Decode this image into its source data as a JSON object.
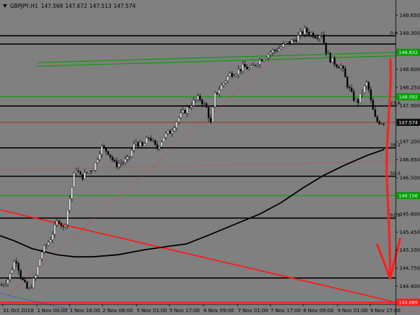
{
  "header": {
    "symbol": "GBPJPY,H1",
    "open": "147.568",
    "high": "147.672",
    "low": "147.513",
    "close": "147.574"
  },
  "colors": {
    "background": "#808080",
    "bull": "#000000",
    "bear": "#000000",
    "level_black": "#000000",
    "level_green": "#0a9c0a",
    "trend_red": "#ff1a1a",
    "ma": "#000000",
    "annotation": "#ff2020",
    "price_badge": "#111111",
    "green_badge": "#0a9c0a",
    "red_badge": "#ff1a1a"
  },
  "chart_data": {
    "type": "candlestick",
    "symbol": "GBPJPY",
    "timeframe": "H1",
    "ylim": [
      144.05,
      149.75
    ],
    "y_ticks": [
      "149.650",
      "149.300",
      "148.950",
      "148.600",
      "148.250",
      "147.900",
      "147.200",
      "146.850",
      "146.500",
      "145.800",
      "145.450",
      "145.100",
      "144.750",
      "144.400"
    ],
    "x_ticks": [
      "31 Oct 2018",
      "1 Nov 00:00",
      "1 Nov 16:00",
      "2 Nov 08:00",
      "5 Nov 01:00",
      "5 Nov 17:00",
      "6 Nov 09:00",
      "7 Nov 01:00",
      "7 Nov 17:00",
      "8 Nov 09:00",
      "9 Nov 01:00",
      "9 Nov 17:00"
    ],
    "current_price": "147.574",
    "horizontal_levels": [
      {
        "price": 149.25,
        "color": "black",
        "fib_label": "0.0"
      },
      {
        "price": 149.09,
        "color": "black",
        "fib_label": ""
      },
      {
        "price": 148.07,
        "color": "green",
        "badge": "148.092"
      },
      {
        "price": 147.89,
        "color": "black",
        "fib_label": "23.6"
      },
      {
        "price": 147.574,
        "color": "red-thin",
        "badge": "147.574"
      },
      {
        "price": 147.08,
        "color": "black",
        "fib_label": "38.2"
      },
      {
        "price": 146.53,
        "color": "black",
        "fib_label": "50.0"
      },
      {
        "price": 146.156,
        "color": "green",
        "badge": "146.156"
      },
      {
        "price": 145.72,
        "color": "black",
        "fib_label": "61.8"
      },
      {
        "price": 144.56,
        "color": "black",
        "fib_label": ""
      },
      {
        "price": 144.089,
        "color": "red",
        "badge": "144.089"
      }
    ],
    "sloped_lines": [
      {
        "name": "green-channel-upper",
        "color": "green",
        "from": {
          "x": "1 Nov 00:00",
          "price": 148.73
        },
        "to": {
          "x": "9 Nov 17:00",
          "price": 148.93
        },
        "badge": "148.832"
      },
      {
        "name": "green-channel-lower",
        "color": "green",
        "from": {
          "x": "1 Nov 00:00",
          "price": 148.66
        },
        "to": {
          "x": "9 Nov 17:00",
          "price": 148.86
        }
      },
      {
        "name": "red-trendline",
        "color": "red",
        "from": {
          "x": "31 Oct 2018",
          "price": 145.88
        },
        "to": {
          "x": "9 Nov 17:00",
          "price": 144.09
        }
      },
      {
        "name": "red-dotted-diagonal",
        "color": "red-dotted",
        "from": {
          "x": "31 Oct 2018",
          "price": 144.09
        },
        "to": {
          "x": "8 Nov 09:00",
          "price": 149.3
        }
      },
      {
        "name": "red-dotted-near-flat",
        "color": "red-dotted",
        "from": {
          "x": "31 Oct 2018",
          "price": 146.65
        },
        "to": {
          "x": "9 Nov 17:00",
          "price": 146.82
        }
      },
      {
        "name": "blue-dotted",
        "color": "blue-dotted",
        "from": {
          "x": "31 Oct 2018",
          "price": 144.26
        },
        "to": {
          "x": "1 Nov 16:00",
          "price": 143.95
        }
      }
    ],
    "moving_average": [
      [
        0,
        145.38
      ],
      [
        20,
        145.28
      ],
      [
        45,
        145.13
      ],
      [
        80,
        145.01
      ],
      [
        105,
        144.97
      ],
      [
        130,
        144.97
      ],
      [
        165,
        145.01
      ],
      [
        205,
        145.11
      ],
      [
        240,
        145.18
      ],
      [
        262,
        145.22
      ],
      [
        295,
        145.4
      ],
      [
        330,
        145.6
      ],
      [
        365,
        145.8
      ],
      [
        395,
        146.02
      ],
      [
        425,
        146.3
      ],
      [
        455,
        146.55
      ],
      [
        485,
        146.75
      ],
      [
        515,
        146.93
      ],
      [
        540,
        147.05
      ]
    ],
    "arrow_annotation": {
      "color": "red",
      "from_price": 148.8,
      "to_price": 144.55
    }
  }
}
